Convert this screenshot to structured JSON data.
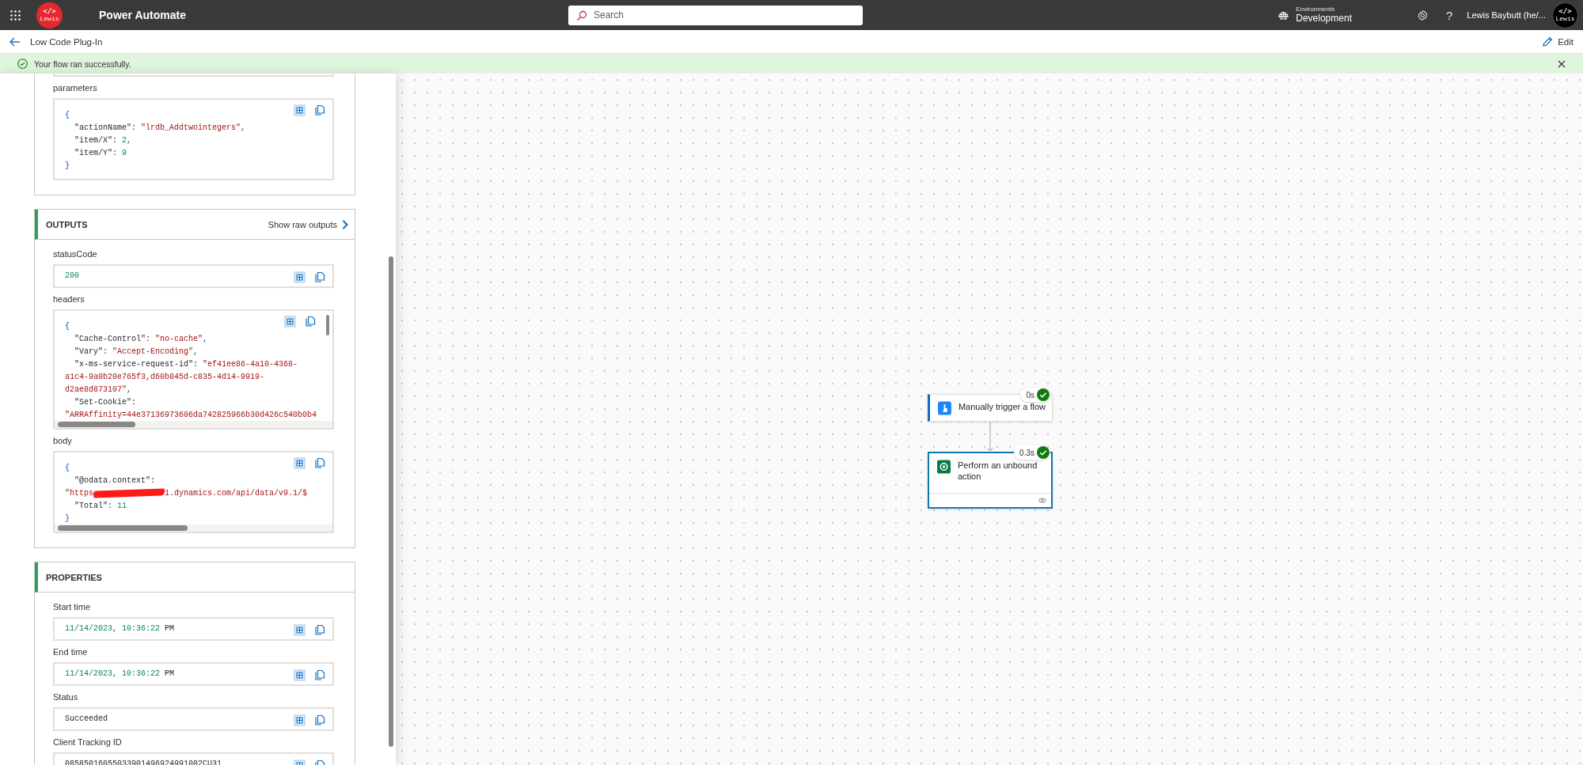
{
  "top_bar": {
    "logo": {
      "line_1": "</>",
      "line_2": "Lewis"
    },
    "app_name": "Power Automate",
    "search": {
      "placeholder": "Search"
    },
    "environment": {
      "label": "Environments",
      "name": "Development"
    },
    "help": "?",
    "user_name": "Lewis Baybutt (he/...",
    "avatar": {
      "line_1": "</>",
      "line_2": "Lewis"
    }
  },
  "header": {
    "title": "Low Code Plug-In",
    "edit_button": "Edit"
  },
  "banner": {
    "message": "Your flow ran successfully."
  },
  "details": {
    "sections": [
      {
        "fields": [
          {
            "label": "parameters",
            "kind": "code",
            "lines": [
              {
                "indented": false,
                "segments": [
                  {
                    "kind": "brace",
                    "text": "{"
                  }
                ]
              },
              {
                "indented": true,
                "segments": [
                  {
                    "kind": "key",
                    "text": "\"actionName\":"
                  },
                  {
                    "kind": "string",
                    "text": "\"lrdb_Addtwointegers\""
                  },
                  {
                    "kind": "comma",
                    "text": ","
                  }
                ]
              },
              {
                "indented": true,
                "segments": [
                  {
                    "kind": "key",
                    "text": "\"item/X\":"
                  },
                  {
                    "kind": "number",
                    "text": "2"
                  },
                  {
                    "kind": "comma",
                    "text": ","
                  }
                ]
              },
              {
                "indented": true,
                "segments": [
                  {
                    "kind": "key",
                    "text": "\"item/Y\":"
                  },
                  {
                    "kind": "number",
                    "text": "9"
                  }
                ]
              },
              {
                "indented": false,
                "segments": [
                  {
                    "kind": "brace",
                    "text": "}"
                  }
                ]
              }
            ]
          }
        ]
      },
      {
        "title": "OUTPUTS",
        "link": "Show raw outputs",
        "fields": [
          {
            "label": "statusCode",
            "kind": "value",
            "lines": [
              {
                "indented": false,
                "segments": [
                  {
                    "kind": "number",
                    "text": "200"
                  }
                ]
              }
            ]
          },
          {
            "label": "headers",
            "kind": "code-scroll-xy",
            "lines": [
              {
                "indented": false,
                "segments": [
                  {
                    "kind": "brace",
                    "text": "{"
                  }
                ]
              },
              {
                "indented": true,
                "segments": [
                  {
                    "kind": "key",
                    "text": "\"Cache-Control\":"
                  },
                  {
                    "kind": "string",
                    "text": "\"no-cache\""
                  },
                  {
                    "kind": "comma",
                    "text": ","
                  }
                ]
              },
              {
                "indented": true,
                "segments": [
                  {
                    "kind": "key",
                    "text": "\"Vary\":"
                  },
                  {
                    "kind": "string",
                    "text": "\"Accept-Encoding\""
                  },
                  {
                    "kind": "comma",
                    "text": ","
                  }
                ]
              },
              {
                "indented": true,
                "segments": [
                  {
                    "kind": "key",
                    "text": "\"x-ms-service-request-id\":"
                  },
                  {
                    "kind": "string",
                    "text": "\"ef41ee86-4a10-4368-"
                  }
                ]
              },
              {
                "indented": false,
                "segments": [
                  {
                    "kind": "string",
                    "text": "a1c4-9a0b20e765f3,d60b845d-c835-4d14-9919-"
                  }
                ]
              },
              {
                "indented": false,
                "segments": [
                  {
                    "kind": "string",
                    "text": "d2ae8d873107\""
                  },
                  {
                    "kind": "comma",
                    "text": ","
                  }
                ]
              },
              {
                "indented": true,
                "segments": [
                  {
                    "kind": "key",
                    "text": "\"Set-Cookie\":"
                  }
                ]
              },
              {
                "indented": false,
                "segments": [
                  {
                    "kind": "string",
                    "text": "\"ARRAffinity=44e37136973606da742825966b30d426c540b0b4"
                  }
                ]
              }
            ]
          },
          {
            "label": "body",
            "kind": "code-scroll-x",
            "lines": [
              {
                "indented": false,
                "segments": [
                  {
                    "kind": "brace",
                    "text": "{"
                  }
                ]
              },
              {
                "indented": true,
                "segments": [
                  {
                    "kind": "key",
                    "text": "\"@odata.context\":"
                  }
                ]
              },
              {
                "indented": false,
                "segments": [
                  {
                    "kind": "string",
                    "text": "\"https"
                  },
                  {
                    "kind": "redacted"
                  },
                  {
                    "kind": "string",
                    "text": "1.dynamics.com/api/data/v9.1/$"
                  }
                ]
              },
              {
                "indented": true,
                "segments": [
                  {
                    "kind": "key",
                    "text": "\"Total\":"
                  },
                  {
                    "kind": "number",
                    "text": "11"
                  }
                ]
              },
              {
                "indented": false,
                "segments": [
                  {
                    "kind": "brace",
                    "text": "}"
                  }
                ]
              }
            ]
          }
        ]
      },
      {
        "title": "PROPERTIES",
        "fields": [
          {
            "label": "Start time",
            "kind": "value",
            "lines": [
              {
                "indented": false,
                "segments": [
                  {
                    "kind": "number",
                    "text": "11/14/2023"
                  },
                  {
                    "kind": "comma",
                    "text": ","
                  },
                  {
                    "kind": "number",
                    "text": "10:36:22"
                  },
                  {
                    "kind": "plain",
                    "text": "PM"
                  }
                ]
              }
            ]
          },
          {
            "label": "End time",
            "kind": "value",
            "lines": [
              {
                "indented": false,
                "segments": [
                  {
                    "kind": "number",
                    "text": "11/14/2023"
                  },
                  {
                    "kind": "comma",
                    "text": ","
                  },
                  {
                    "kind": "number",
                    "text": "10:36:22"
                  },
                  {
                    "kind": "plain",
                    "text": "PM"
                  }
                ]
              }
            ]
          },
          {
            "label": "Status",
            "kind": "value",
            "lines": [
              {
                "indented": false,
                "segments": [
                  {
                    "kind": "plain",
                    "text": "Succeeded"
                  }
                ]
              }
            ]
          },
          {
            "label": "Client Tracking ID",
            "kind": "value",
            "lines": [
              {
                "indented": false,
                "segments": [
                  {
                    "kind": "plain",
                    "text": "08585016055033901496924991002CU31"
                  }
                ]
              }
            ]
          }
        ]
      }
    ]
  },
  "canvas": {
    "steps": [
      {
        "kind": "trigger",
        "title": "Manually trigger a flow",
        "duration": "0s",
        "selected": false
      },
      {
        "kind": "action",
        "title": "Perform an unbound action",
        "duration": "0.3s",
        "selected": true
      }
    ]
  }
}
